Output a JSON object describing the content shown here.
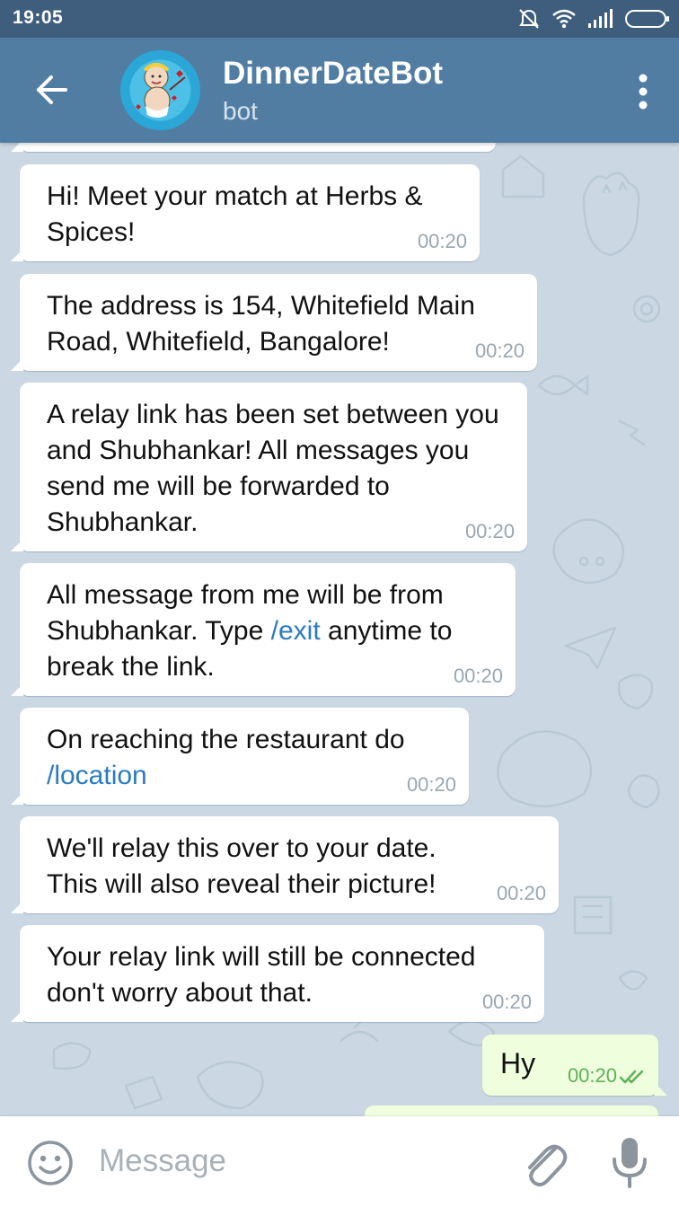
{
  "status_bar": {
    "time": "19:05",
    "icons": [
      "mute-alarm-icon",
      "wifi-icon",
      "signal-icon",
      "battery-icon"
    ]
  },
  "header": {
    "back_icon": "arrow-left-icon",
    "title": "DinnerDateBot",
    "subtitle": "bot",
    "menu_icon": "more-vertical-icon"
  },
  "messages": [
    {
      "direction": "in",
      "text": "Hi! Meet your match at Herbs & Spices!",
      "time": "00:20"
    },
    {
      "direction": "in",
      "text": "The address is 154, Whitefield Main Road, Whitefield, Bangalore!",
      "time": "00:20"
    },
    {
      "direction": "in",
      "text": "A relay link has been set between you and Shubhankar! All messages you send me will be forwarded to Shubhankar.",
      "time": "00:20"
    },
    {
      "direction": "in",
      "text_before": "All message from me will be from Shubhankar. Type ",
      "command": "/exit",
      "text_after": " anytime to break the link.",
      "time": "00:20"
    },
    {
      "direction": "in",
      "text": "On reaching the restaurant do ",
      "command": "/location",
      "time": "00:20"
    },
    {
      "direction": "in",
      "text": "We'll relay this over to your date. This will also reveal their picture!",
      "time": "00:20"
    },
    {
      "direction": "in",
      "text": "Your relay link will still be connected don't worry about that.",
      "time": "00:20"
    },
    {
      "direction": "out",
      "text": "Hy",
      "time": "00:20",
      "status": "read"
    }
  ],
  "input": {
    "placeholder": "Message",
    "value": ""
  },
  "colors": {
    "header": "#527da3",
    "status_bar": "#3f5e7e",
    "incoming_bubble": "#ffffff",
    "outgoing_bubble": "#effedd",
    "link": "#2a7bc1",
    "chat_background": "#cbd8e3"
  }
}
